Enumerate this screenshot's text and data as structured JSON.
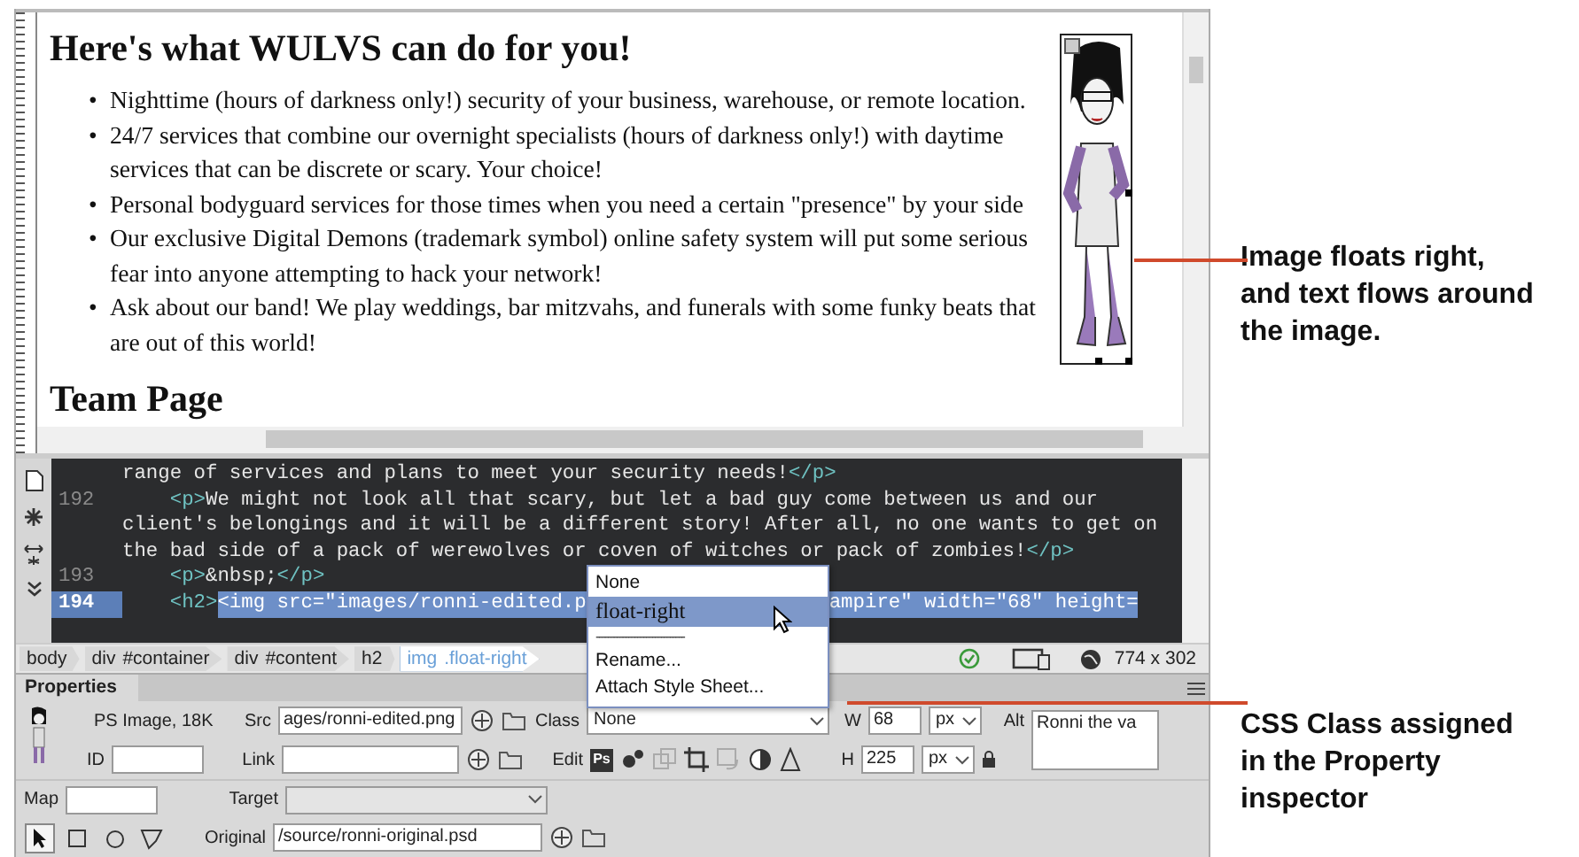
{
  "design_view": {
    "heading": "Here's what WULVS can do for you!",
    "bullets": [
      {
        "marker": "•",
        "text": "Nighttime (hours of darkness only!) security of your business, warehouse, or remote location."
      },
      {
        "marker": "•",
        "text": "24/7 services that combine our overnight specialists (hours of darkness only!) with daytime services that can be discrete or scary. Your choice!"
      },
      {
        "marker": "•",
        "text": "Personal bodyguard services for those times when you need a certain \"presence\" by your side"
      },
      {
        "marker": "•",
        "text": "Our exclusive Digital Demons (trademark symbol) online safety system will put some serious fear into anyone attempting to hack your network!"
      },
      {
        "marker": "•",
        "text": "Ask about our band! We play weddings, bar mitzvahs, and funerals with some funky beats that are out of this world!"
      }
    ],
    "next_heading": "Team Page"
  },
  "code_view": {
    "lines": [
      {
        "selected": false,
        "segments": [
          {
            "kind": "text",
            "text": "range of services and plans to meet your security needs!"
          },
          {
            "kind": "tag",
            "text": "</p>"
          }
        ]
      },
      {
        "number": "192",
        "selected": false,
        "segments": [
          {
            "kind": "tag",
            "text": "    <p>"
          },
          {
            "kind": "text",
            "text": "We might not look all that scary, but let a bad guy come between us and our"
          }
        ]
      },
      {
        "selected": false,
        "segments": [
          {
            "kind": "text",
            "text": "client's belongings and it will be a different story! After all, no one wants to get on"
          }
        ]
      },
      {
        "selected": false,
        "segments": [
          {
            "kind": "text",
            "text": "the bad side of a pack of werewolves or coven of witches or pack of zombies!"
          },
          {
            "kind": "tag",
            "text": "</p>"
          }
        ]
      },
      {
        "number": "193",
        "selected": false,
        "segments": [
          {
            "kind": "tag",
            "text": "    <p>"
          },
          {
            "kind": "text",
            "text": "&nbsp;"
          },
          {
            "kind": "tag",
            "text": "</p>"
          }
        ]
      },
      {
        "number": "194",
        "selected": true,
        "segments": [
          {
            "kind": "tag",
            "text": "    <h2>"
          },
          {
            "kind": "tag",
            "text": "<img src=\"images/ronni-edited.p",
            "selected": true
          },
          {
            "kind": "tag",
            "text": "ampire\" width=\"68\" height=",
            "selected": true,
            "gap_before": true
          }
        ]
      }
    ]
  },
  "class_menu": {
    "items": [
      {
        "kind": "item",
        "label": "None",
        "selected": false
      },
      {
        "kind": "item",
        "label": "float-right",
        "selected": true
      },
      {
        "kind": "separator",
        "label": "------------------------------"
      },
      {
        "kind": "item",
        "label": "Rename...",
        "selected": false
      },
      {
        "kind": "item",
        "label": "Attach Style Sheet...",
        "selected": false
      }
    ]
  },
  "tag_selector": [
    {
      "label": "body",
      "selected": false
    },
    {
      "label": "div",
      "detail": "#container",
      "selected": false
    },
    {
      "label": "div",
      "detail": "#content",
      "selected": false
    },
    {
      "label": "h2",
      "selected": false
    },
    {
      "label": "img",
      "detail": ".float-right",
      "selected": true
    }
  ],
  "window_size": "774 x 302",
  "properties": {
    "title": "Properties",
    "image_info": "PS Image, 18K",
    "src": {
      "label": "Src",
      "value": "ages/ronni-edited.png"
    },
    "class": {
      "label": "Class",
      "value": "None"
    },
    "w": {
      "label": "W",
      "value": "68",
      "unit": "px"
    },
    "alt": {
      "label": "Alt",
      "value": "Ronni the va"
    },
    "id": {
      "label": "ID"
    },
    "link": {
      "label": "Link"
    },
    "edit_label": "Edit",
    "edit_tools": [
      {
        "kind": "photoshop",
        "label": "Ps",
        "disabled": false
      },
      {
        "kind": "settings",
        "disabled": false
      },
      {
        "kind": "optimize",
        "disabled": true
      },
      {
        "kind": "crop",
        "disabled": false
      },
      {
        "kind": "resample",
        "disabled": true
      },
      {
        "kind": "brightness",
        "disabled": false
      },
      {
        "kind": "sharpen",
        "disabled": false
      }
    ],
    "h": {
      "label": "H",
      "value": "225",
      "unit": "px"
    },
    "map": {
      "label": "Map"
    },
    "target": {
      "label": "Target",
      "disabled": true
    },
    "hotspot_tools": [
      {
        "kind": "pointer",
        "selected": true
      },
      {
        "kind": "rectangle",
        "selected": false
      },
      {
        "kind": "circle",
        "selected": false
      },
      {
        "kind": "polygon",
        "selected": false
      }
    ],
    "original": {
      "label": "Original",
      "value": "/source/ronni-original.psd"
    }
  },
  "callouts": [
    {
      "text": "Image floats right, and text flows around the image."
    },
    {
      "text": "CSS Class assigned in the Property inspector"
    }
  ]
}
